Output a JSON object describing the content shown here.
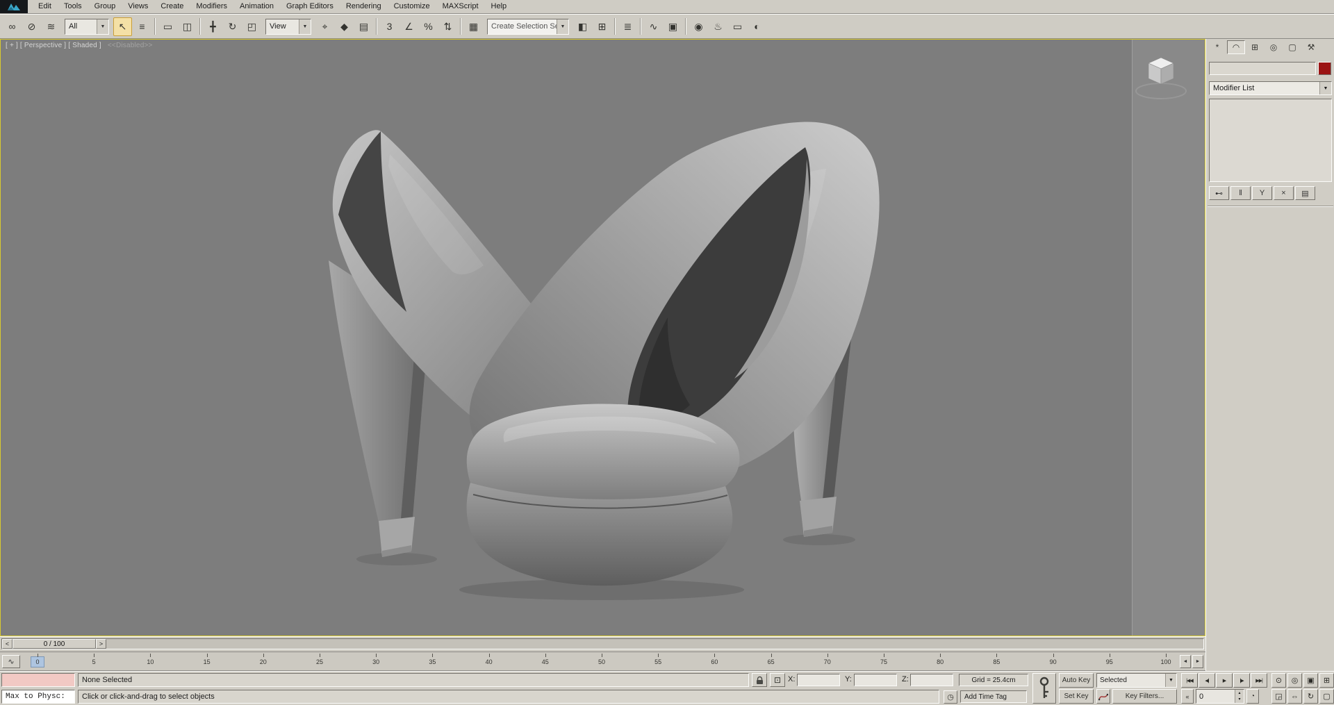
{
  "ui": {
    "dropdown_arrow": "▼",
    "spinner_up": "▴",
    "spinner_down": "▾"
  },
  "menu_bar": {
    "items": [
      "Edit",
      "Tools",
      "Group",
      "Views",
      "Create",
      "Modifiers",
      "Animation",
      "Graph Editors",
      "Rendering",
      "Customize",
      "MAXScript",
      "Help"
    ]
  },
  "toolbar": {
    "selection_filter_value": "All",
    "coordinate_system_value": "View",
    "named_selection_placeholder": "Create Selection Se",
    "group1": [
      {
        "name": "select-and-link",
        "glyph": "∞"
      },
      {
        "name": "unlink-selection",
        "glyph": "⊘"
      },
      {
        "name": "bind-to-space-warp",
        "glyph": "≋"
      }
    ],
    "group2": [
      {
        "name": "select-object",
        "glyph": "↖",
        "active": true
      },
      {
        "name": "select-by-name",
        "glyph": "≡"
      },
      {
        "sep": true
      },
      {
        "name": "rectangular-selection-region",
        "glyph": "▭"
      },
      {
        "name": "window-crossing",
        "glyph": "◫"
      },
      {
        "sep": true
      },
      {
        "name": "select-and-move",
        "glyph": "╋"
      },
      {
        "name": "select-and-rotate",
        "glyph": "↻"
      },
      {
        "name": "select-and-uniform-scale",
        "glyph": "◰"
      }
    ],
    "group3": [
      {
        "name": "use-pivot-point-center",
        "glyph": "⌖"
      },
      {
        "name": "select-and-manipulate",
        "glyph": "◆"
      },
      {
        "name": "keyboard-shortcut-override",
        "glyph": "▤"
      },
      {
        "sep": true
      },
      {
        "name": "snaps-toggle",
        "glyph": "3"
      },
      {
        "name": "angle-snap-toggle",
        "glyph": "∠"
      },
      {
        "name": "percent-snap-toggle",
        "glyph": "%"
      },
      {
        "name": "spinner-snap-toggle",
        "glyph": "⇅"
      },
      {
        "sep": true
      },
      {
        "name": "edit-named-selection-sets",
        "glyph": "▦"
      }
    ],
    "group4": [
      {
        "name": "mirror",
        "glyph": "◧"
      },
      {
        "name": "align",
        "glyph": "⊞"
      },
      {
        "sep": true
      },
      {
        "name": "layer-manager",
        "glyph": "≣"
      },
      {
        "sep": true
      },
      {
        "name": "curve-editor",
        "glyph": "∿"
      },
      {
        "name": "schematic-view",
        "glyph": "▣"
      },
      {
        "sep": true
      },
      {
        "name": "material-editor",
        "glyph": "◉"
      },
      {
        "name": "render-setup",
        "glyph": "♨"
      },
      {
        "name": "rendered-frame-window",
        "glyph": "▭"
      },
      {
        "name": "quick-render",
        "glyph": "◐"
      }
    ]
  },
  "viewport": {
    "label": "[ + ] [ Perspective ] [ Shaded ]",
    "disabled_label": "<<Disabled>>",
    "background": "#7d7d7d"
  },
  "command_panel": {
    "tabs": [
      {
        "name": "create-tab",
        "glyph": "*"
      },
      {
        "name": "modify-tab",
        "glyph": "◠",
        "active": true
      },
      {
        "name": "hierarchy-tab",
        "glyph": "⊞"
      },
      {
        "name": "motion-tab",
        "glyph": "◎"
      },
      {
        "name": "display-tab",
        "glyph": "▢"
      },
      {
        "name": "utilities-tab",
        "glyph": "⚒"
      }
    ],
    "object_name_value": "",
    "object_color": "#9b1414",
    "modifier_list_label": "Modifier List",
    "stack_buttons": [
      {
        "name": "pin-stack",
        "glyph": "⊷"
      },
      {
        "name": "show-end-result",
        "glyph": "ǁ"
      },
      {
        "name": "make-unique",
        "glyph": "Y"
      },
      {
        "name": "remove-modifier",
        "glyph": "×"
      },
      {
        "name": "configure-modifier-sets",
        "glyph": "▤"
      }
    ]
  },
  "timeline": {
    "current_display": "0 / 100",
    "prev_glyph": "<",
    "next_glyph": ">",
    "mini_curve_glyph": "∿",
    "end_prev_glyph": "◄",
    "end_next_glyph": "►",
    "ticks": [
      "0",
      "5",
      "10",
      "15",
      "20",
      "25",
      "30",
      "35",
      "40",
      "45",
      "50",
      "55",
      "60",
      "65",
      "70",
      "75",
      "80",
      "85",
      "90",
      "95",
      "100"
    ]
  },
  "status_bar": {
    "listener_line1": "",
    "listener_line2": "Max to Physc:",
    "selection_status": "None Selected",
    "prompt": "Click or click-and-drag to select objects",
    "x_label": "X:",
    "y_label": "Y:",
    "z_label": "Z:",
    "x_value": "",
    "y_value": "",
    "z_value": "",
    "grid_display": "Grid = 25.4cm",
    "time_tag_icon_glyph": "◷",
    "add_time_tag": "Add Time Tag",
    "auto_key_label": "Auto Key",
    "set_key_label": "Set Key",
    "selected_value": "Selected",
    "key_filters_label": "Key Filters...",
    "frame_value": "0",
    "key_mode_glyph": "«",
    "time_config_glyph": "◔",
    "playback": [
      {
        "name": "go-to-start",
        "glyph": "|◀◀"
      },
      {
        "name": "previous-frame",
        "glyph": "◀|"
      },
      {
        "name": "play",
        "glyph": "▶"
      },
      {
        "name": "next-frame",
        "glyph": "|▶"
      },
      {
        "name": "go-to-end",
        "glyph": "▶▶|"
      }
    ],
    "nav": [
      {
        "name": "zoom",
        "glyph": "⊙"
      },
      {
        "name": "zoom-all",
        "glyph": "◎"
      },
      {
        "name": "zoom-extents",
        "glyph": "▣"
      },
      {
        "name": "zoom-extents-all",
        "glyph": "⊞"
      },
      {
        "name": "zoom-region",
        "glyph": "◲"
      },
      {
        "name": "pan",
        "glyph": "⇔"
      },
      {
        "name": "orbit",
        "glyph": "↻"
      },
      {
        "name": "maximize-viewport-toggle",
        "glyph": "▢"
      }
    ]
  }
}
